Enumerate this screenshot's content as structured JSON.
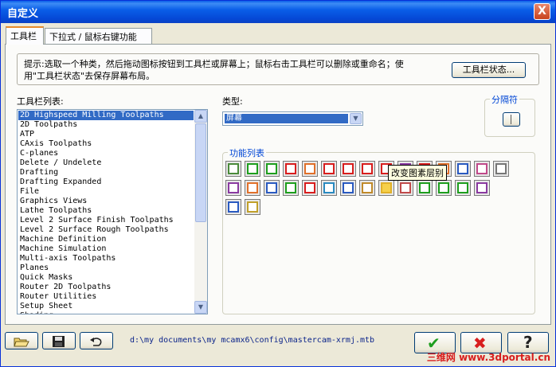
{
  "window": {
    "title": "自定义",
    "close_glyph": "X"
  },
  "tabs": [
    {
      "label": "工具栏",
      "active": true
    },
    {
      "label": "下拉式 / 鼠标右键功能",
      "active": false
    }
  ],
  "hint": {
    "line1": "提示:选取一个种类，然后拖动图标按钮到工具栏或屏幕上；鼠标右击工具栏可以删除或重命名；使",
    "line2": "用\"工具栏状态\"去保存屏幕布局。",
    "state_button": "工具栏状态..."
  },
  "toolbar_list": {
    "label": "工具栏列表:",
    "items": [
      "2D Highspeed Milling Toolpaths",
      "2D Toolpaths",
      "ATP",
      "CAxis Toolpaths",
      "C-planes",
      "Delete / Undelete",
      "Drafting",
      "Drafting Expanded",
      "File",
      "Graphics Views",
      "Lathe Toolpaths",
      "Level 2 Surface Finish Toolpaths",
      "Level 2 Surface Rough Toolpaths",
      "Machine Definition",
      "Machine Simulation",
      "Multi-axis Toolpaths",
      "Planes",
      "Quick Masks",
      "Router 2D Toolpaths",
      "Router Utilities",
      "Setup Sheet",
      "Shading"
    ],
    "selected_index": 0
  },
  "type": {
    "label": "类型:",
    "value": "屏幕"
  },
  "separator": {
    "label": "分隔符"
  },
  "functions": {
    "label": "功能列表",
    "tooltip": "改变图素层别",
    "icons": [
      "surface-stripes-icon",
      "green-arrow-right-icon",
      "green-plus-icon",
      "red-minus-icon",
      "orange-diamond-icon",
      "red-square-icon",
      "red-split-h-icon",
      "red-split-v-icon",
      "red-grid-icon",
      "purple-rotate-icon",
      "crosshair-icon",
      "orange-triangle-icon",
      "sigma-icon",
      "dots-grid-icon",
      "camera-icon",
      "purple-curve-icon",
      "orange-x-icon",
      "blue-x-icon",
      "green-x-icon",
      "down-arrow-icon",
      "target-icon",
      "blue-window-icon",
      "picture-icon",
      "level-change-icon",
      "palette-icon",
      "green-star-icon",
      "green-lines-icon",
      "green-bars-icon",
      "purple-copy-icon",
      "blue-square-icon",
      "hourglass-icon"
    ]
  },
  "bottom": {
    "open_icon": "folder-open-icon",
    "save_icon": "floppy-disk-icon",
    "undo_icon": "undo-arrow-icon",
    "path": "d:\\my documents\\my mcamx6\\config\\mastercam-xrmj.mtb",
    "ok_icon": "green-check-icon",
    "cancel_icon": "red-x-icon",
    "help_icon": "question-mark-icon",
    "ok_glyph": "✔",
    "cancel_glyph": "✖",
    "help_glyph": "?",
    "watermark": "三维网 www.3dportal.cn"
  },
  "colors": {
    "accent": "#0a5ee8",
    "selection": "#316ac5",
    "ok": "#1e9e1e",
    "cancel": "#d81e1e"
  }
}
